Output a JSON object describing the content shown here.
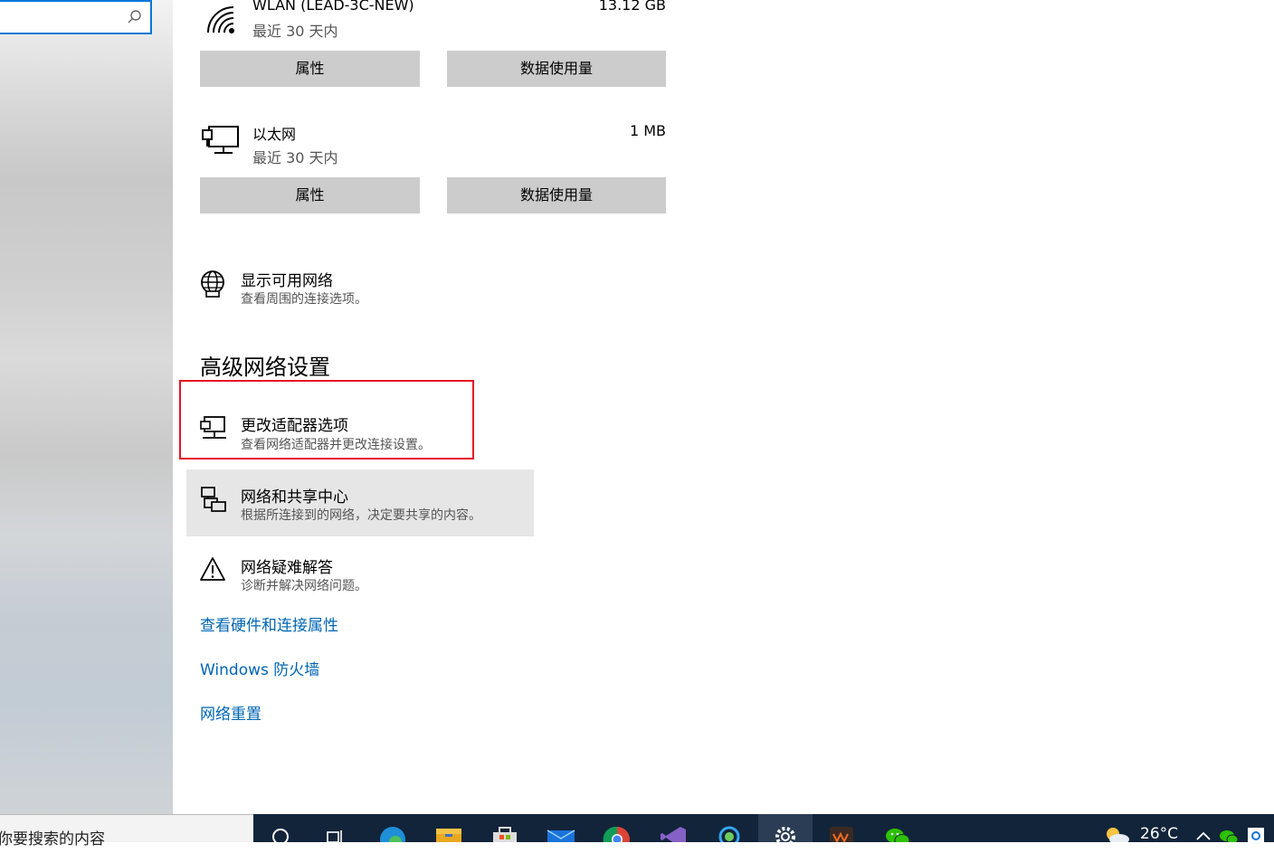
{
  "search": {
    "placeholder": ""
  },
  "connections": [
    {
      "name": "WLAN (LEAD-3C-NEW)",
      "period": "最近 30 天内",
      "usage": "13.12 GB",
      "icon": "wifi-icon",
      "properties_label": "属性",
      "data_usage_label": "数据使用量"
    },
    {
      "name": "以太网",
      "period": "最近 30 天内",
      "usage": "1 MB",
      "icon": "ethernet-icon",
      "properties_label": "属性",
      "data_usage_label": "数据使用量"
    }
  ],
  "show_networks": {
    "title": "显示可用网络",
    "subtitle": "查看周围的连接选项。",
    "icon": "globe-icon"
  },
  "advanced": {
    "heading": "高级网络设置",
    "items": [
      {
        "title": "更改适配器选项",
        "subtitle": "查看网络适配器并更改连接设置。",
        "icon": "adapter-icon"
      },
      {
        "title": "网络和共享中心",
        "subtitle": "根据所连接到的网络，决定要共享的内容。",
        "icon": "sharing-center-icon"
      },
      {
        "title": "网络疑难解答",
        "subtitle": "诊断并解决网络问题。",
        "icon": "warning-icon"
      }
    ],
    "links": [
      "查看硬件和连接属性",
      "Windows 防火墙",
      "网络重置"
    ]
  },
  "taskbar": {
    "search_text": "你要搜索的内容",
    "apps": [
      "search-icon",
      "task-view-icon",
      "edge-icon",
      "file-explorer-icon",
      "store-icon",
      "mail-icon",
      "chrome-icon",
      "visual-studio-icon",
      "magnifier-icon",
      "settings-icon",
      "wps-icon",
      "wechat-icon"
    ],
    "temperature": "26°C",
    "colors": {
      "taskbar": "#12243a",
      "accent": "#0078d7",
      "highlight": "#e81123",
      "link": "#0066b4"
    }
  }
}
